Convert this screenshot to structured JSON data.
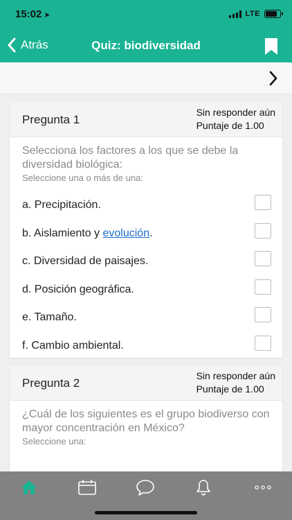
{
  "status": {
    "time": "15:02",
    "network": "LTE"
  },
  "nav": {
    "back_label": "Atrás",
    "title": "Quiz: biodiversidad"
  },
  "questions": [
    {
      "title": "Pregunta 1",
      "status": "Sin responder aún",
      "score": "Puntaje de 1.00",
      "text": "Selecciona los factores a los que se debe la diversidad biológica:",
      "hint": "Seleccione una o más de una:",
      "options": [
        {
          "label": "a. Precipitación."
        },
        {
          "label_pre": "b. Aislamiento y ",
          "link": "evolución",
          "label_post": "."
        },
        {
          "label": "c. Diversidad de paisajes."
        },
        {
          "label": "d. Posición geográfica."
        },
        {
          "label": "e. Tamaño."
        },
        {
          "label": "f. Cambio ambiental."
        }
      ]
    },
    {
      "title": "Pregunta 2",
      "status": "Sin responder aún",
      "score": "Puntaje de 1.00",
      "text": "¿Cuál de los siguientes es el grupo biodiverso con mayor concentración en México?",
      "hint": "Seleccione una:"
    }
  ],
  "tabs": [
    {
      "icon": "home-icon",
      "active": true
    },
    {
      "icon": "calendar-icon",
      "active": false
    },
    {
      "icon": "chat-icon",
      "active": false
    },
    {
      "icon": "bell-icon",
      "active": false
    },
    {
      "icon": "more-icon",
      "active": false
    }
  ],
  "colors": {
    "brand": "#1ab394",
    "link": "#1c6fc9",
    "tabbar": "#828282",
    "active_tab": "#1ab394",
    "inactive_tab": "#ffffff"
  }
}
